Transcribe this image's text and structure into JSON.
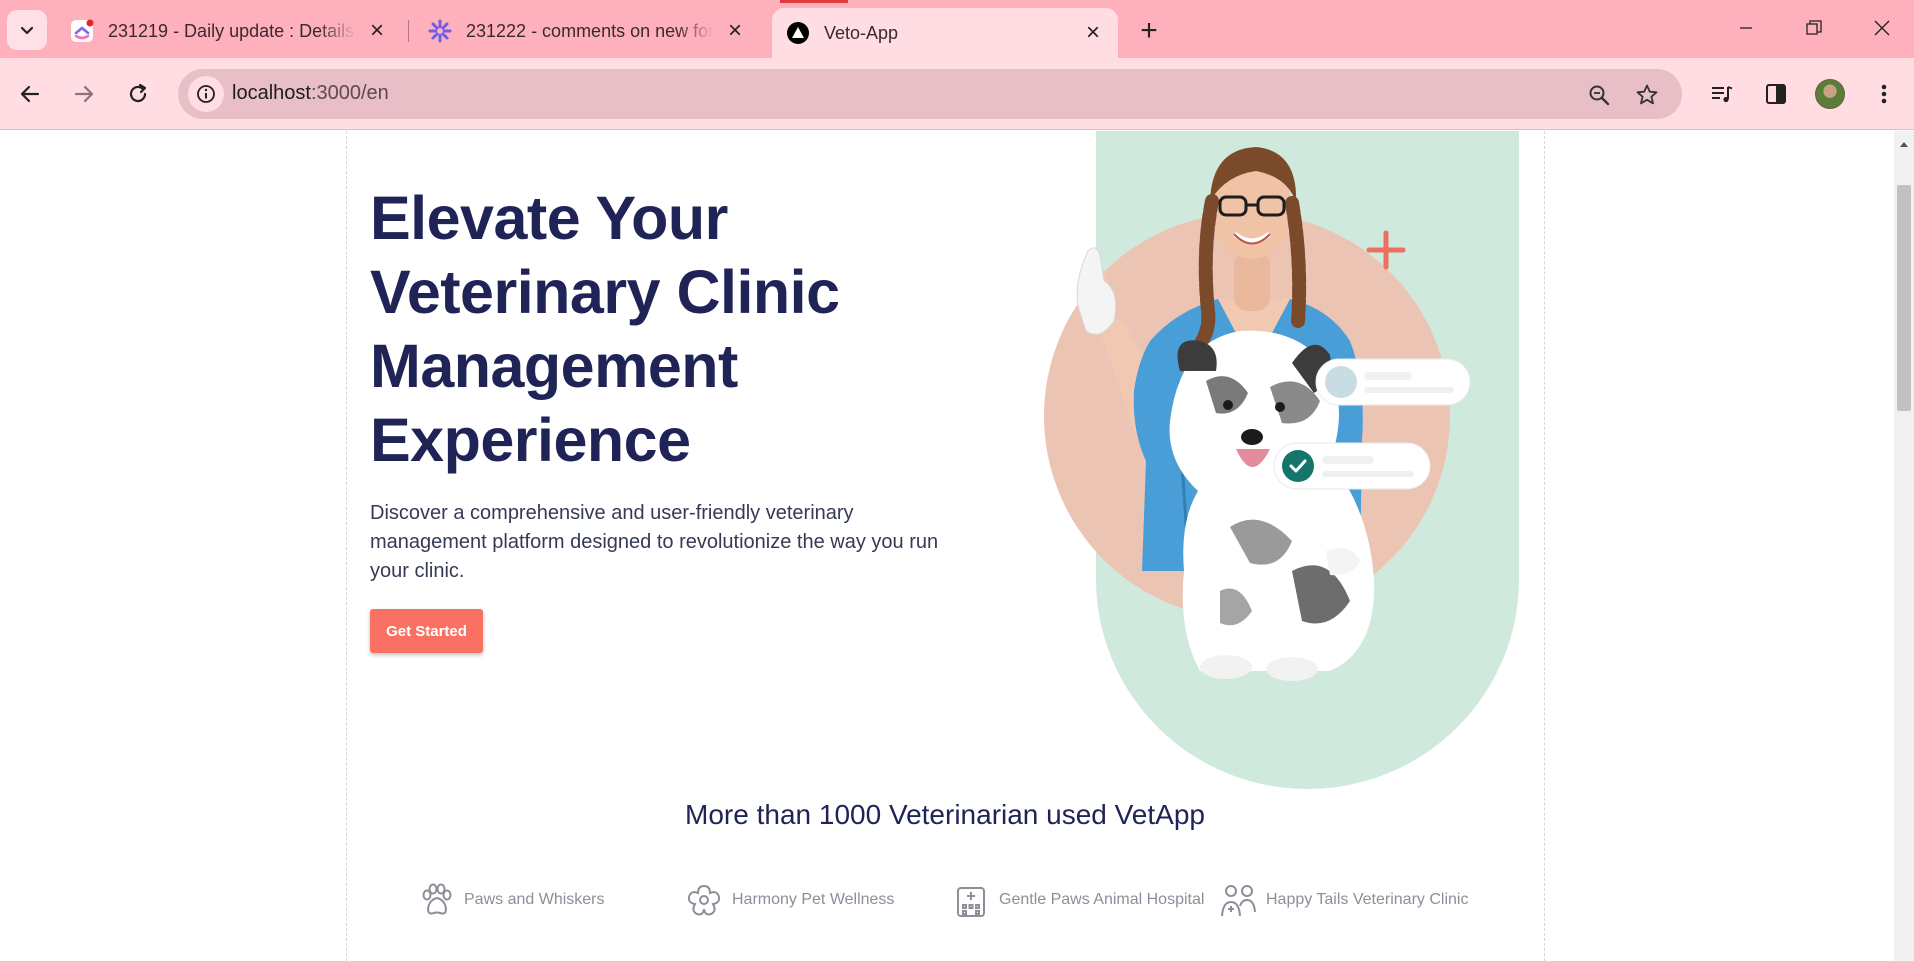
{
  "browser": {
    "tabs": [
      {
        "title": "231219 - Daily update : Details",
        "favicon": "clickup-icon"
      },
      {
        "title": "231222 - comments on new for",
        "favicon": "asterisk-icon"
      },
      {
        "title": "Veto-App",
        "favicon": "nextjs-triangle-icon",
        "active": true
      }
    ],
    "url_host": "localhost",
    "url_path": ":3000/en",
    "icons": [
      "tab-search-icon",
      "back-icon",
      "forward-icon",
      "reload-icon",
      "site-info-icon",
      "zoom-icon",
      "bookmark-star-icon",
      "media-controls-icon",
      "side-panel-icon",
      "profile-avatar",
      "more-menu-icon",
      "minimize-icon",
      "restore-icon",
      "close-window-icon",
      "new-tab-icon"
    ]
  },
  "hero": {
    "title_line1": "Elevate Your",
    "title_line2": "Veterinary Clinic",
    "title_line3": "Management",
    "title_line4": "Experience",
    "description": "Discover a comprehensive and user-friendly veterinary management platform designed to revolutionize the way you run your clinic.",
    "cta_label": "Get Started"
  },
  "colors": {
    "title": "#1f2356",
    "cta": "#f87162",
    "mint": "#cfe9dd",
    "peach": "#e8c2b2",
    "tab_bar": "#ffb0bd",
    "toolbar": "#ffdde3"
  },
  "social_proof": {
    "title": "More than 1000 Veterinarian used VetApp",
    "logos": [
      {
        "name": "Paws and Whiskers",
        "icon": "paw-icon"
      },
      {
        "name": "Harmony Pet Wellness",
        "icon": "flower-icon"
      },
      {
        "name": "Gentle Paws Animal Hospital",
        "icon": "hospital-building-icon"
      },
      {
        "name": "Happy Tails Veterinary Clinic",
        "icon": "people-icon"
      }
    ]
  }
}
